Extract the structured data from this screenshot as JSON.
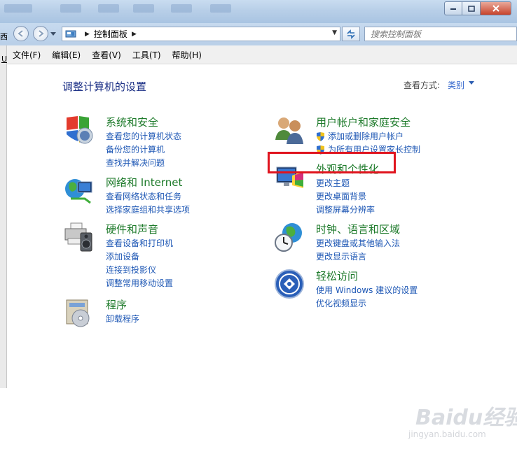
{
  "address": {
    "crumb": "控制面板"
  },
  "search": {
    "placeholder": "搜索控制面板"
  },
  "menu": [
    "文件(F)",
    "编辑(E)",
    "查看(V)",
    "工具(T)",
    "帮助(H)"
  ],
  "page": {
    "heading": "调整计算机的设置",
    "view_by_label": "查看方式:",
    "view_by_value": "类别"
  },
  "categories": [
    {
      "title": "系统和安全",
      "icon": "shield-computer-icon",
      "links": [
        "查看您的计算机状态",
        "备份您的计算机",
        "查找并解决问题"
      ]
    },
    {
      "title": "网络和 Internet",
      "icon": "globe-network-icon",
      "links": [
        "查看网络状态和任务",
        "选择家庭组和共享选项"
      ]
    },
    {
      "title": "硬件和声音",
      "icon": "printer-speaker-icon",
      "links": [
        "查看设备和打印机",
        "添加设备",
        "连接到投影仪",
        "调整常用移动设置"
      ]
    },
    {
      "title": "程序",
      "icon": "program-disk-icon",
      "links": [
        "卸载程序"
      ]
    },
    {
      "title": "用户帐户和家庭安全",
      "icon": "users-icon",
      "links": [
        "添加或删除用户帐户",
        "为所有用户设置家长控制"
      ]
    },
    {
      "title": "外观和个性化",
      "icon": "monitor-paint-icon",
      "links": [
        "更改主题",
        "更改桌面背景",
        "调整屏幕分辨率"
      ]
    },
    {
      "title": "时钟、语言和区域",
      "icon": "clock-globe-icon",
      "links": [
        "更改键盘或其他输入法",
        "更改显示语言"
      ]
    },
    {
      "title": "轻松访问",
      "icon": "ease-of-access-icon",
      "links": [
        "使用 Windows 建议的设置",
        "优化视频显示"
      ]
    }
  ],
  "watermark": {
    "brand": "Baidu经验",
    "url": "jingyan.baidu.com"
  },
  "colors": {
    "category_title": "#1d7a2a",
    "link": "#1f58b5",
    "heading": "#1e3287",
    "highlight": "#e0141e"
  }
}
